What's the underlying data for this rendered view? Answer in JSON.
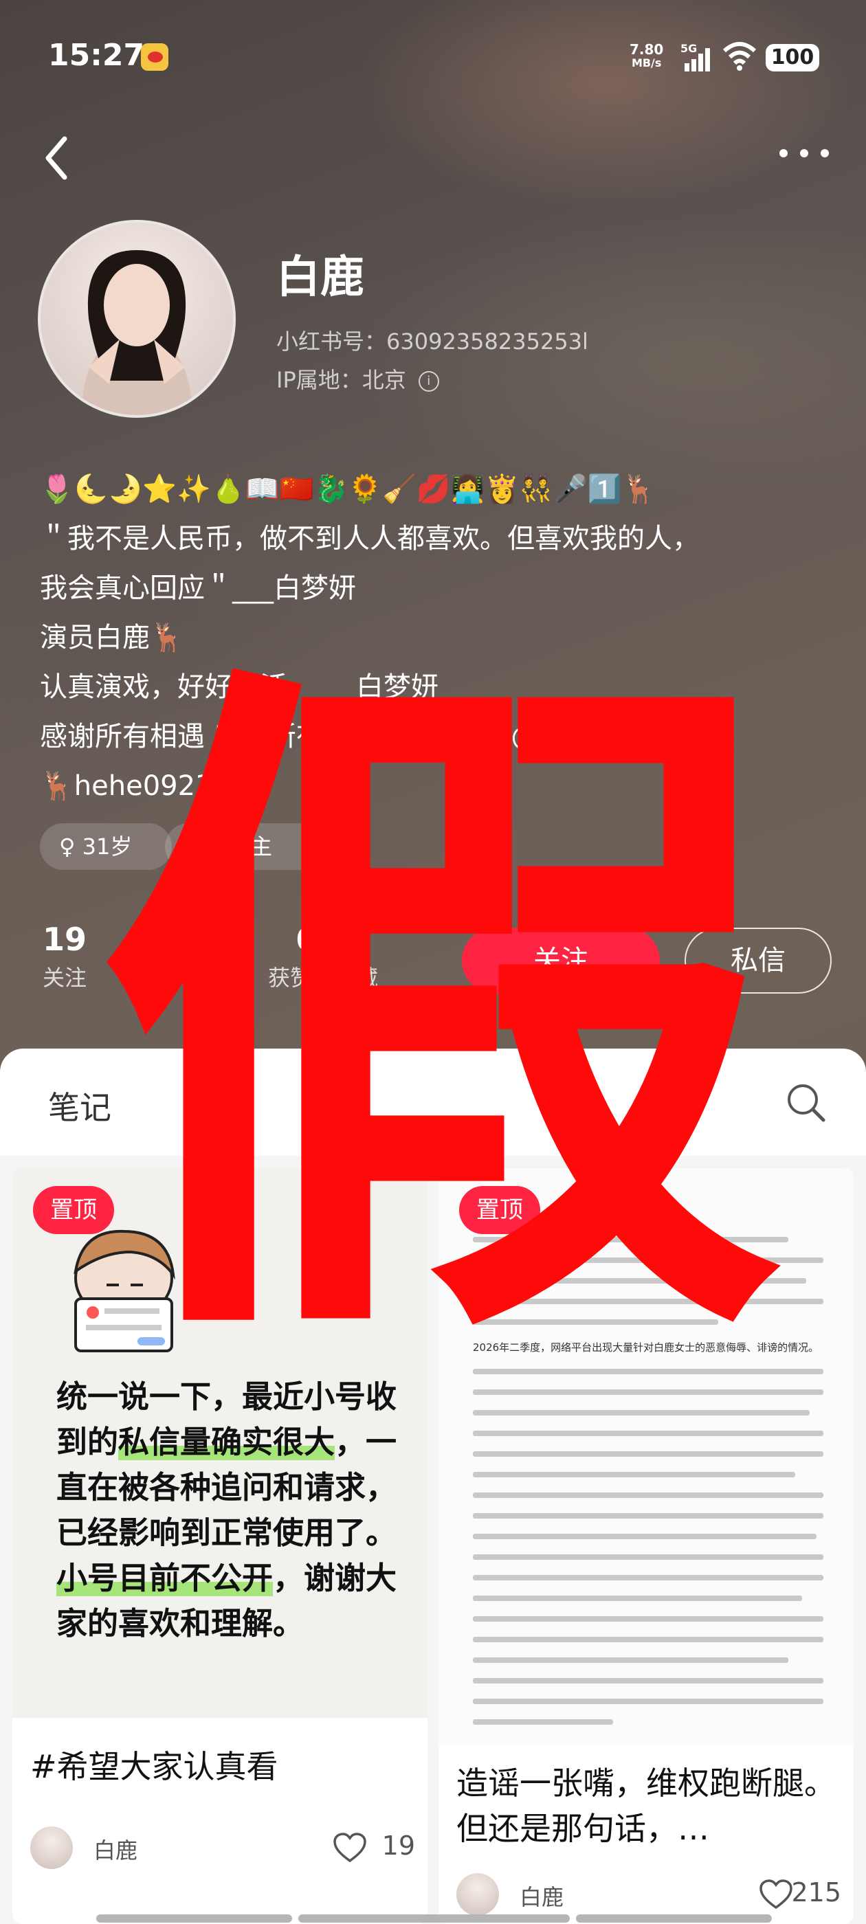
{
  "status_bar": {
    "time": "15:27",
    "net_speed_top": "7.80",
    "net_speed_bottom": "MB/s",
    "network": "5G",
    "battery": "100"
  },
  "profile": {
    "name": "白鹿",
    "redbook_id": "小红书号：63092358235253l",
    "ip": "IP属地：北京",
    "bio": [
      "🌷🌜🌛⭐✨🍐📖🇨🇳🐉🌻🧹💋👩‍💻👸👯🎤1️⃣🦌",
      "＂我不是人民币，做不到人人都喜欢。但喜欢我的人，",
      "我会真心回应＂___白梦妍",
      "演员白鹿🦌",
      "认真演戏，好好生活。___白梦妍",
      "感谢所有相遇 感谢所有等待___白梦妍  @er_923",
      "🦌hehe0923"
    ],
    "tags": {
      "age": "♀ 31岁",
      "role": "视频博主"
    }
  },
  "stats": {
    "following": {
      "value": "19",
      "label": "关注"
    },
    "fans": {
      "value": "",
      "label": ""
    },
    "likes": {
      "value": "6",
      "label": "获赞与收藏"
    }
  },
  "actions": {
    "follow": "关注",
    "message": "私信"
  },
  "tabs": {
    "notes": "笔记"
  },
  "notes": [
    {
      "pin": "置顶",
      "cover_text": [
        {
          "text": "统一说一下，最近小",
          "hl": false
        },
        {
          "text": "号收到的",
          "hl": false
        },
        {
          "text": "私信量确实",
          "hl": true
        },
        {
          "text": "很大",
          "hl": true
        },
        {
          "text": "，一直在被各种追问和请求，已经影响到正常使用了。",
          "hl": false
        },
        {
          "text": "小号目前不公开",
          "hl": true
        },
        {
          "text": "，谢谢大家的喜欢和理解。",
          "hl": false
        }
      ],
      "title": "#希望大家认真看",
      "author": "白鹿",
      "likes": "19"
    },
    {
      "pin": "置顶",
      "doc_heading": "2026年二季度，网络平台出现大量针对白鹿女士的恶意侮辱、诽谤的情况。",
      "title": "造谣一张嘴，维权跑断腿。但还是那句话，…",
      "author": "白鹿",
      "likes": "215"
    }
  ],
  "overlay_stamp": "假",
  "colors": {
    "accent": "#ff2442",
    "stamp": "#ff0a0a",
    "highlight": "#a6e57a"
  }
}
